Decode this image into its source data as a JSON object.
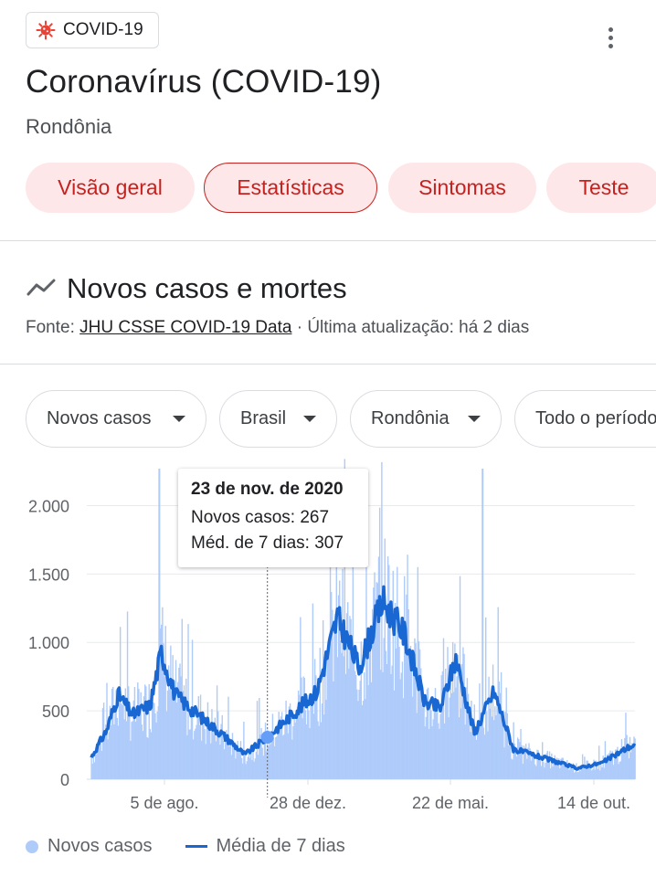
{
  "header": {
    "chip_label": "COVID-19",
    "title": "Coronavírus (COVID-19)",
    "location": "Rondônia"
  },
  "tabs": [
    {
      "label": "Visão geral",
      "active": false
    },
    {
      "label": "Estatísticas",
      "active": true
    },
    {
      "label": "Sintomas",
      "active": false
    },
    {
      "label": "Teste",
      "active": false
    }
  ],
  "section": {
    "title": "Novos casos e mortes",
    "source_prefix": "Fonte: ",
    "source_link": "JHU CSSE COVID-19 Data",
    "source_suffix": " · Última atualização: há 2 dias"
  },
  "filters": [
    {
      "label": "Novos casos"
    },
    {
      "label": "Brasil"
    },
    {
      "label": "Rondônia"
    },
    {
      "label": "Todo o período"
    }
  ],
  "tooltip": {
    "date": "23 de nov. de 2020",
    "cases_line": "Novos casos: 267",
    "avg_line": "Méd. de 7 dias: 307"
  },
  "legend": {
    "cases": "Novos casos",
    "avg": "Média de 7 dias"
  },
  "colors": {
    "bars": "#aecbfa",
    "avg_line": "#1967d2",
    "accent": "#c5221f"
  },
  "chart_data": {
    "type": "bar",
    "yticks": [
      "2.000",
      "1.500",
      "1.000",
      "500",
      "0"
    ],
    "ytick_values": [
      2000,
      1500,
      1000,
      500,
      0
    ],
    "xticks": [
      "5 de ago.",
      "28 de dez.",
      "22 de mai.",
      "14 de out."
    ],
    "ylim": [
      0,
      2270
    ],
    "series": [
      {
        "name": "Novos casos",
        "type": "bar"
      },
      {
        "name": "Média de 7 dias",
        "type": "line",
        "points": [
          {
            "x": "2020-06-05",
            "y": 160
          },
          {
            "x": "2020-06-20",
            "y": 360
          },
          {
            "x": "2020-07-01",
            "y": 620
          },
          {
            "x": "2020-07-15",
            "y": 470
          },
          {
            "x": "2020-08-01",
            "y": 540
          },
          {
            "x": "2020-08-12",
            "y": 930
          },
          {
            "x": "2020-08-25",
            "y": 620
          },
          {
            "x": "2020-09-15",
            "y": 480
          },
          {
            "x": "2020-10-10",
            "y": 330
          },
          {
            "x": "2020-11-01",
            "y": 180
          },
          {
            "x": "2020-11-23",
            "y": 307
          },
          {
            "x": "2020-12-15",
            "y": 460
          },
          {
            "x": "2021-01-10",
            "y": 640
          },
          {
            "x": "2021-01-30",
            "y": 1180
          },
          {
            "x": "2021-02-20",
            "y": 820
          },
          {
            "x": "2021-03-15",
            "y": 1300
          },
          {
            "x": "2021-04-05",
            "y": 1060
          },
          {
            "x": "2021-04-25",
            "y": 560
          },
          {
            "x": "2021-05-10",
            "y": 520
          },
          {
            "x": "2021-05-25",
            "y": 880
          },
          {
            "x": "2021-06-12",
            "y": 340
          },
          {
            "x": "2021-07-01",
            "y": 640
          },
          {
            "x": "2021-07-20",
            "y": 220
          },
          {
            "x": "2021-08-25",
            "y": 140
          },
          {
            "x": "2021-09-20",
            "y": 80
          },
          {
            "x": "2021-10-14",
            "y": 120
          },
          {
            "x": "2021-11-10",
            "y": 240
          }
        ]
      }
    ],
    "spikes": [
      {
        "x": "2020-08-10",
        "y": 2270
      },
      {
        "x": "2021-06-20",
        "y": 2270
      }
    ],
    "highlight": {
      "x": "2020-11-23",
      "cases": 267,
      "avg": 307
    }
  }
}
